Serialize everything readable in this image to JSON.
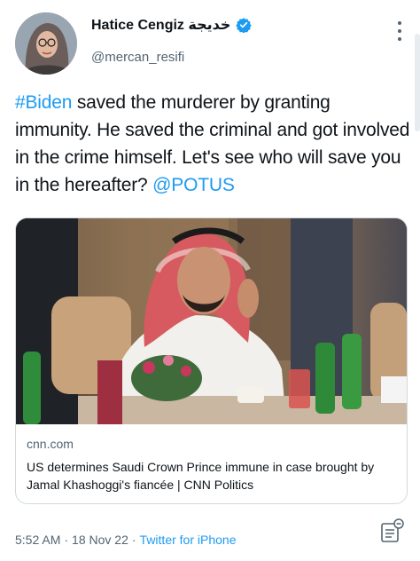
{
  "user": {
    "display_name": "Hatice Cengiz خديجة",
    "handle": "@mercan_resifi"
  },
  "tweet": {
    "hashtag": "#Biden",
    "text_part1": " saved the murderer by granting immunity. He saved the criminal and got involved in the crime himself. Let's see who will save you in the hereafter? ",
    "mention": "@POTUS"
  },
  "card": {
    "domain": "cnn.com",
    "title": "US determines Saudi Crown Prince immune in case brought by Jamal Khashoggi's fiancée | CNN Politics"
  },
  "meta": {
    "time": "5:52 AM",
    "separator1": "·",
    "date": "18 Nov 22",
    "separator2": "·",
    "source": "Twitter for iPhone"
  },
  "colors": {
    "accent": "#1d9bf0",
    "text": "#0f1419",
    "muted": "#536471"
  }
}
